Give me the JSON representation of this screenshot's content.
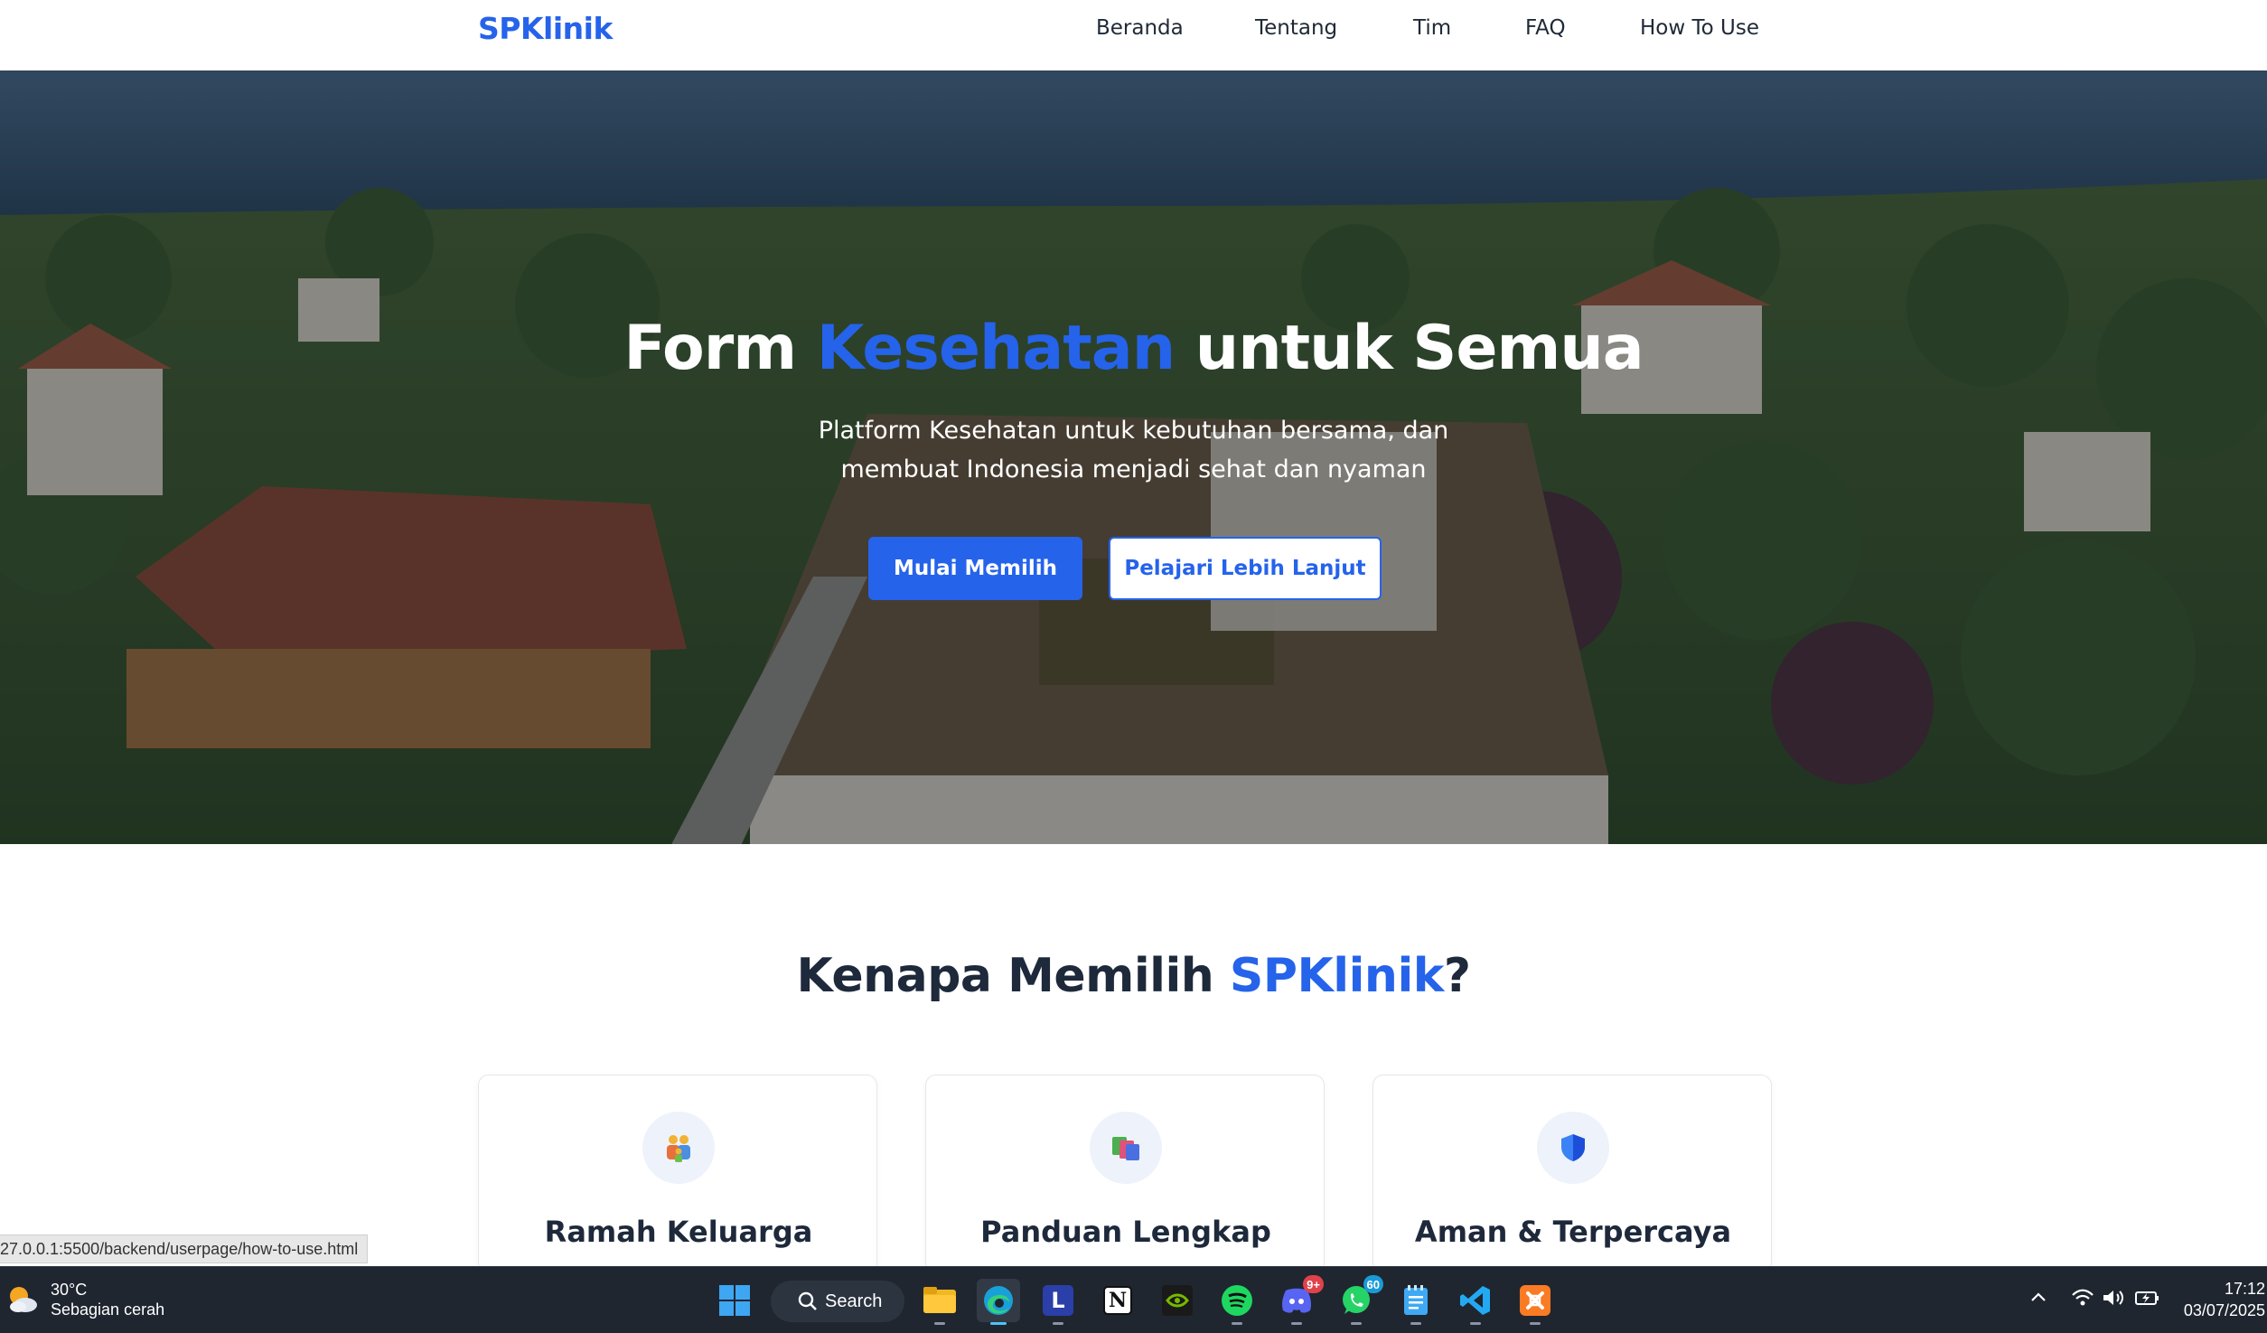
{
  "navbar": {
    "brand": "SPKlinik",
    "links": [
      "Beranda",
      "Tentang",
      "Tim",
      "FAQ",
      "How To Use"
    ]
  },
  "hero": {
    "title_part1": "Form ",
    "title_accent": "Kesehatan",
    "title_part2": " untuk Semua",
    "subtitle_line1": "Platform Kesehatan untuk kebutuhan bersama, dan",
    "subtitle_line2": "membuat Indonesia menjadi sehat dan nyaman",
    "primary_button": "Mulai Memilih",
    "secondary_button": "Pelajari Lebih Lanjut"
  },
  "why": {
    "title_part1": "Kenapa Memilih ",
    "title_accent": "SPKlinik",
    "title_part2": "?",
    "cards": [
      {
        "title": "Ramah Keluarga",
        "icon": "family-icon"
      },
      {
        "title": "Panduan Lengkap",
        "icon": "books-icon"
      },
      {
        "title": "Aman & Terpercaya",
        "icon": "shield-icon"
      }
    ]
  },
  "status_bar": {
    "url": "27.0.0.1:5500/backend/userpage/how-to-use.html"
  },
  "taskbar": {
    "weather_temp": "30°C",
    "weather_desc": "Sebagian cerah",
    "search_label": "Search",
    "discord_badge": "9+",
    "whatsapp_badge": "60",
    "time": "17:12",
    "date": "03/07/2025"
  },
  "colors": {
    "accent": "#2563eb",
    "heading": "#1e293b",
    "taskbar_bg": "#1f2630"
  }
}
